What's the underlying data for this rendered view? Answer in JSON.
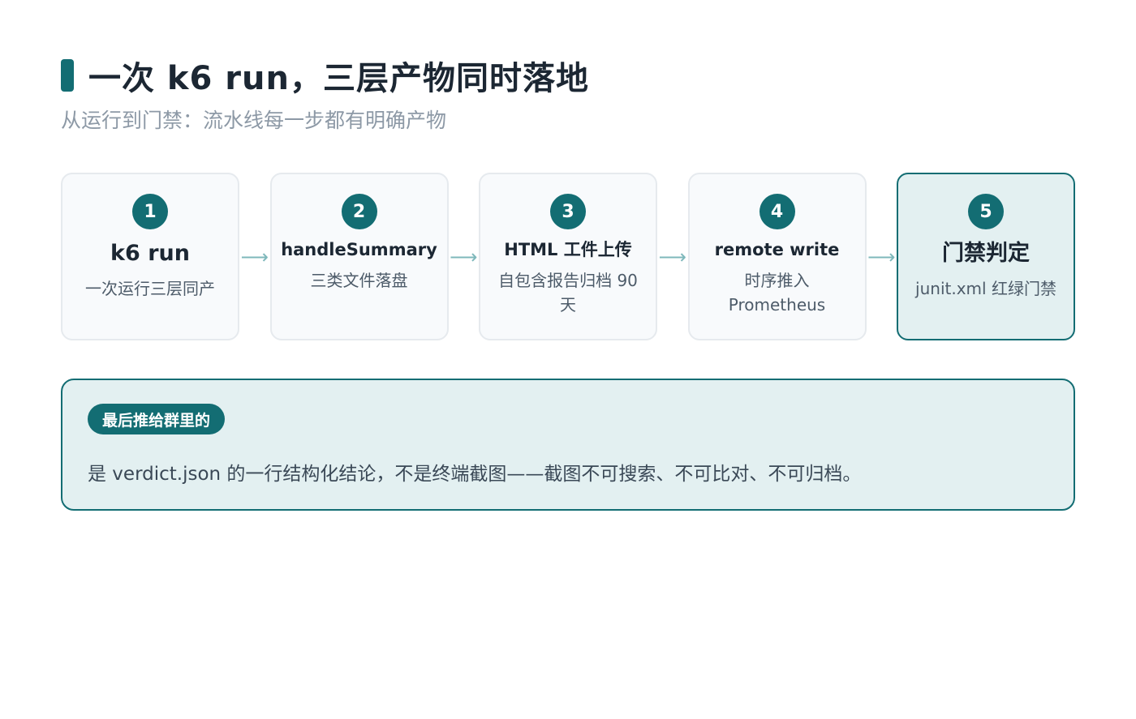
{
  "header": {
    "title": "一次 k6 run，三层产物同时落地",
    "subtitle": "从运行到门禁：流水线每一步都有明确产物"
  },
  "steps": [
    {
      "number": "1",
      "title": "k6 run",
      "desc": "一次运行三层同产"
    },
    {
      "number": "2",
      "title": "handleSummary",
      "desc": "三类文件落盘"
    },
    {
      "number": "3",
      "title": "HTML 工件上传",
      "desc": "自包含报告归档 90 天"
    },
    {
      "number": "4",
      "title": "remote write",
      "desc": "时序推入 Prometheus"
    },
    {
      "number": "5",
      "title": "门禁判定",
      "desc": "junit.xml 红绿门禁"
    }
  ],
  "arrow_glyph": "⟶",
  "note": {
    "tag": "最后推给群里的",
    "text": "是 verdict.json 的一行结构化结论，不是终端截图——截图不可搜索、不可比对、不可归档。"
  },
  "colors": {
    "accent": "#136d73",
    "highlight_bg": "#e3f0f1",
    "card_bg": "#f8fafc",
    "arrow": "#7fb8bb"
  }
}
